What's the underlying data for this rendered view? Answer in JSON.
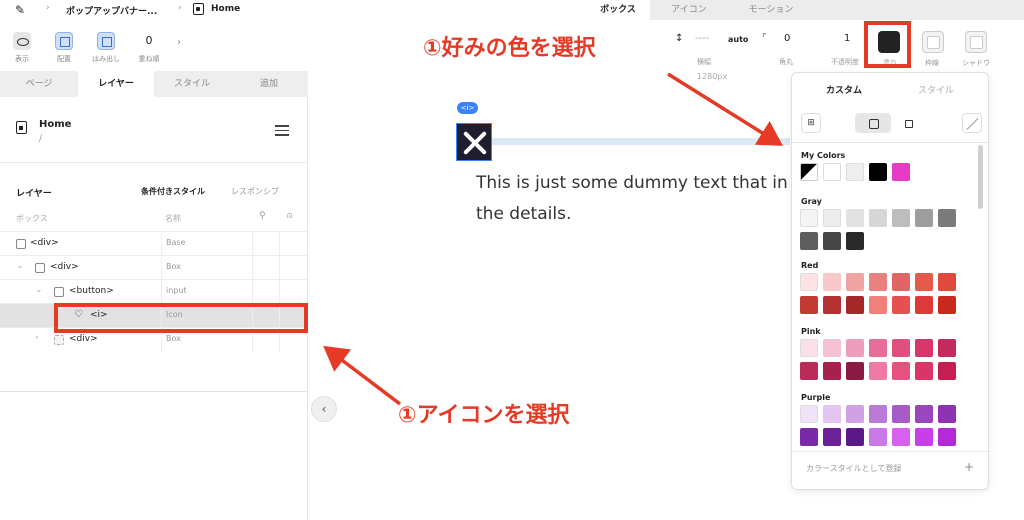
{
  "topbar": {
    "project": "ポップアップバナー...",
    "page": "Home",
    "right_tabs": [
      "ボックス",
      "アイコン",
      "モーション"
    ]
  },
  "toolbar": {
    "left": [
      {
        "name": "show",
        "label": "表示"
      },
      {
        "name": "place",
        "label": "配置"
      },
      {
        "name": "overflow",
        "label": "はみ出し"
      },
      {
        "name": "order",
        "label": "重ね順",
        "value": "0"
      }
    ],
    "right": {
      "width_label": "横幅",
      "width_value": "----",
      "width_auto": "auto",
      "radius_label": "角丸",
      "radius_value": "0",
      "opacity_label": "不透明度",
      "opacity_value": "1",
      "fill_label": "塗り",
      "border_label": "枠線",
      "shadow_label": "シャドウ"
    }
  },
  "left_panel": {
    "tabs": [
      "ページ",
      "レイヤー",
      "スタイル",
      "追加"
    ],
    "active_tab": 1,
    "page_title": "Home",
    "page_path": "/",
    "layer_header": "レイヤー",
    "conditional_style": "条件付きスタイル",
    "responsive": "レスポンシブ",
    "col_box": "ボックス",
    "col_name": "名称",
    "rows": [
      {
        "tag": "<div>",
        "name": "Base"
      },
      {
        "tag": "<div>",
        "name": "Box"
      },
      {
        "tag": "<button>",
        "name": "input"
      },
      {
        "tag": "<i>",
        "name": "Icon"
      },
      {
        "tag": "<div>",
        "name": "Box"
      }
    ]
  },
  "canvas": {
    "width_label": "1280px",
    "badge": "<i>",
    "text": "This is just some dummy text that in the details."
  },
  "color_popover": {
    "tabs": [
      "カスタム",
      "スタイル"
    ],
    "groups": [
      {
        "label": "My Colors",
        "colors": [
          "#000000",
          "#ffffff",
          "#eeeeee",
          "#000000",
          "#e83ac8"
        ]
      },
      {
        "label": "Gray",
        "colors": [
          "#f5f5f5",
          "#ececec",
          "#e2e2e2",
          "#d6d6d6",
          "#bdbdbd",
          "#9e9e9e",
          "#7a7a7a",
          "#5e5e5e",
          "#464646",
          "#2a2a2a"
        ]
      },
      {
        "label": "Red",
        "colors": [
          "#fde3e3",
          "#f8c8c8",
          "#f0a4a4",
          "#e88080",
          "#e06565",
          "#e35a4a",
          "#e04a3a",
          "#c33a33",
          "#b53030",
          "#a52828",
          "#f0807a",
          "#e65050",
          "#de3a3a",
          "#c8281e"
        ]
      },
      {
        "label": "Pink",
        "colors": [
          "#fbe0ea",
          "#f5c2d5",
          "#ee9ebc",
          "#e66d9a",
          "#e0507f",
          "#d9376a",
          "#c42a5c",
          "#b92c58",
          "#a8214c",
          "#8a1a42",
          "#ef7aa6",
          "#e6527f",
          "#d93566",
          "#c51f52"
        ]
      },
      {
        "label": "Purple",
        "colors": [
          "#f1e3f7",
          "#e2c6ef",
          "#d0a2e4",
          "#b97bd6",
          "#a65bc9",
          "#9a46bf",
          "#8e33b4",
          "#7a2aa6",
          "#6a2296",
          "#5a1a86",
          "#c97ae8",
          "#d85ff0",
          "#c83ee8",
          "#b52ad8"
        ]
      }
    ],
    "register_label": "カラースタイルとして登録",
    "plus": "+"
  },
  "annotations": {
    "pick_color": "①好みの色を選択",
    "pick_icon": "①アイコンを選択"
  },
  "accent": "#e53a26"
}
